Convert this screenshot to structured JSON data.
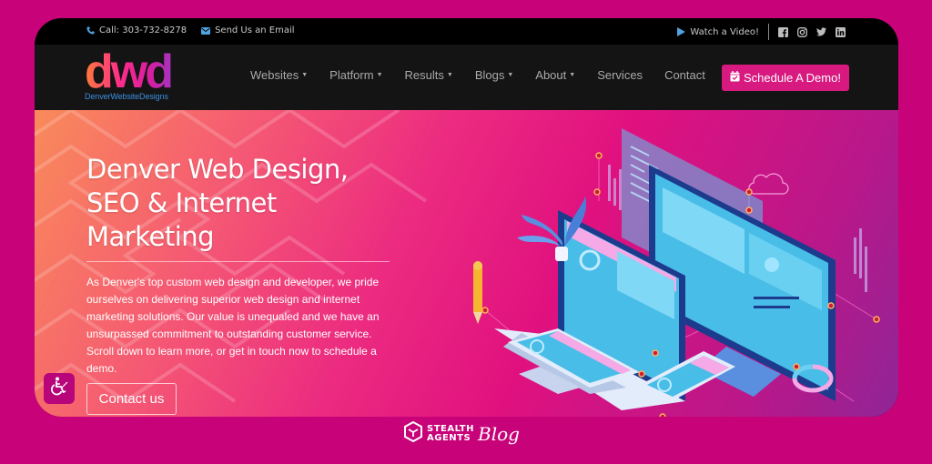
{
  "topbar": {
    "phone_label": "Call: 303-732-8278",
    "email_label": "Send Us an Email",
    "video_label": "Watch a Video!",
    "social": [
      "facebook",
      "instagram",
      "twitter",
      "linkedin"
    ]
  },
  "logo": {
    "mark": "dwd",
    "name": "DenverWebsiteDesigns"
  },
  "nav": {
    "items": [
      {
        "label": "Websites",
        "dropdown": true
      },
      {
        "label": "Platform",
        "dropdown": true
      },
      {
        "label": "Results",
        "dropdown": true
      },
      {
        "label": "Blogs",
        "dropdown": true
      },
      {
        "label": "About",
        "dropdown": true
      },
      {
        "label": "Services",
        "dropdown": false
      },
      {
        "label": "Contact",
        "dropdown": false
      }
    ],
    "cta_label": "Schedule A Demo!"
  },
  "hero": {
    "title_lines": [
      "Denver Web Design,",
      "SEO & Internet",
      "Marketing"
    ],
    "body": "As Denver's top custom web design and developer, we pride ourselves on delivering superior web design and internet marketing solutions. Our value is unequaled and we have an unsurpassed commitment to outstanding customer service.  Scroll down to learn more, or get in touch now to schedule a demo.",
    "cta_label": "Contact us"
  },
  "watermark": {
    "line1": "STEALTH",
    "line2": "AGENTS",
    "script": "Blog"
  },
  "colors": {
    "page_bg": "#c8037a",
    "accent": "#d8197f",
    "link_blue": "#4fa3e0"
  }
}
